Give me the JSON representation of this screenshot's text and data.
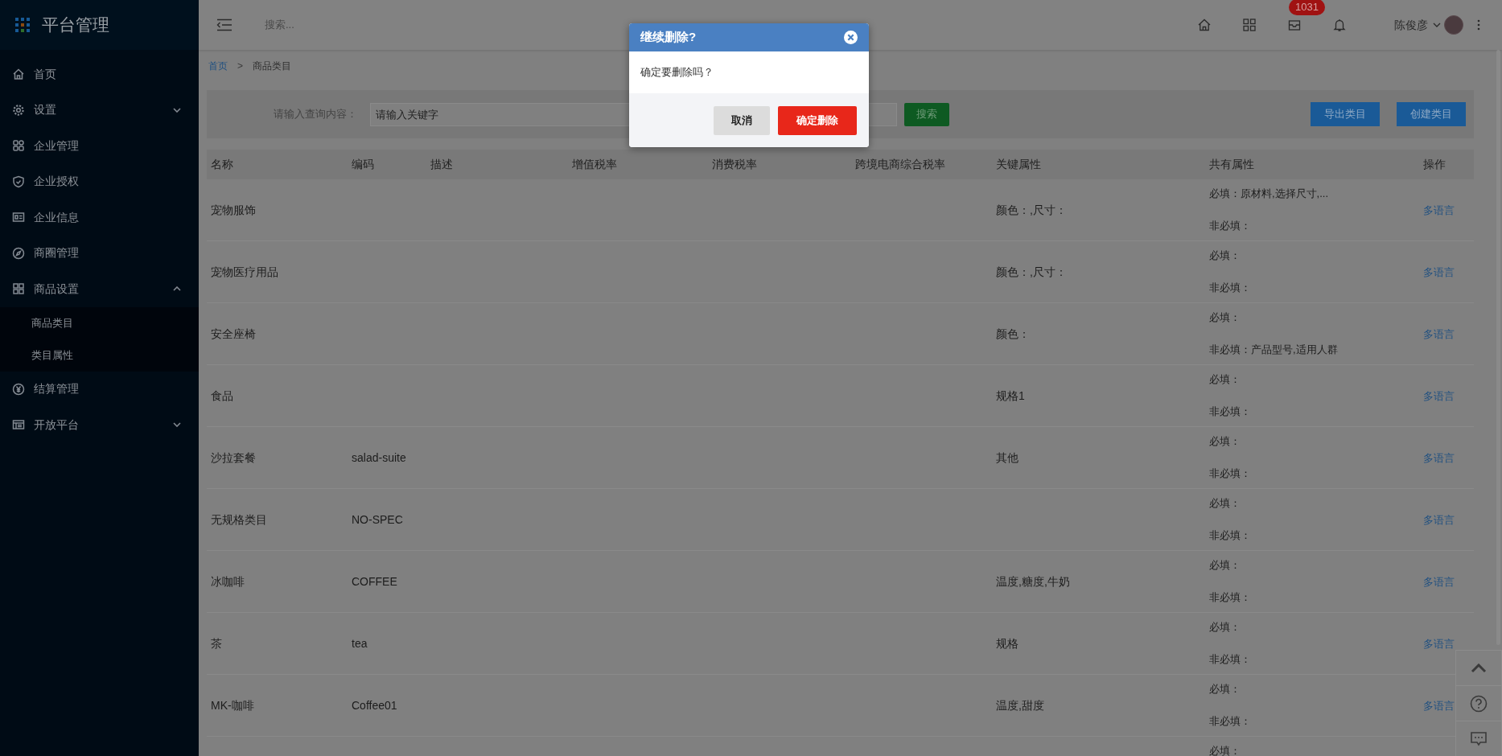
{
  "sidebar": {
    "title": "平台管理",
    "items": [
      {
        "label": "首页",
        "kind": "link"
      },
      {
        "label": "设置",
        "kind": "group",
        "expanded": false
      },
      {
        "label": "企业管理",
        "kind": "link"
      },
      {
        "label": "企业授权",
        "kind": "link"
      },
      {
        "label": "企业信息",
        "kind": "link"
      },
      {
        "label": "商圈管理",
        "kind": "link"
      },
      {
        "label": "商品设置",
        "kind": "group",
        "expanded": true,
        "children": [
          {
            "label": "商品类目"
          },
          {
            "label": "类目属性"
          }
        ]
      },
      {
        "label": "结算管理",
        "kind": "link"
      },
      {
        "label": "开放平台",
        "kind": "group",
        "expanded": false
      }
    ]
  },
  "header": {
    "search_placeholder": "搜索...",
    "badge": "1031",
    "user": "陈俊彦"
  },
  "breadcrumb": [
    {
      "label": "首页",
      "kind": "link"
    },
    {
      "label": ">",
      "kind": "separator"
    },
    {
      "label": "商品类目",
      "kind": "current"
    }
  ],
  "filter": {
    "label": "请输入查询内容：",
    "placeholder": "请输入关键字",
    "search_button": "搜索",
    "buttons": [
      "导出类目",
      "创建类目"
    ]
  },
  "table": {
    "columns": [
      "名称",
      "编码",
      "描述",
      "增值税率",
      "消费税率",
      "跨境电商综合税率",
      "关键属性",
      "共有属性",
      "操作"
    ],
    "rows": [
      {
        "name": "宠物服饰",
        "key_attributes": "颜色：,尺寸：",
        "required": "必填：原材料,选择尺寸,...",
        "optional": "非必填：",
        "action": "多语言"
      },
      {
        "name": "宠物医疗用品",
        "key_attributes": "颜色：,尺寸：",
        "required": "必填：",
        "optional": "非必填：",
        "action": "多语言"
      },
      {
        "name": "安全座椅",
        "key_attributes": "颜色：",
        "required": "必填：",
        "optional": "非必填：产品型号,适用人群",
        "action": "多语言"
      },
      {
        "name": "食品",
        "key_attributes": "规格1",
        "required": "必填：",
        "optional": "非必填：",
        "action": "多语言"
      },
      {
        "name": "沙拉套餐",
        "code": "salad-suite",
        "key_attributes": "其他",
        "required": "必填：",
        "optional": "非必填：",
        "action": "多语言"
      },
      {
        "name": "无规格类目",
        "code": "NO-SPEC",
        "required": "必填：",
        "optional": "非必填：",
        "action": "多语言"
      },
      {
        "name": "冰咖啡",
        "code": "COFFEE",
        "key_attributes": "温度,糖度,牛奶",
        "required": "必填：",
        "optional": "非必填：",
        "action": "多语言"
      },
      {
        "name": "茶",
        "code": "tea",
        "key_attributes": "规格",
        "required": "必填：",
        "optional": "非必填：",
        "action": "多语言"
      },
      {
        "name": "MK-咖啡",
        "code": "Coffee01",
        "key_attributes": "温度,甜度",
        "required": "必填：",
        "optional": "非必填：",
        "action": "多语言"
      },
      {
        "required": "必填："
      }
    ]
  },
  "dialog": {
    "title": "继续删除?",
    "message": "确定要删除吗？",
    "buttons": [
      {
        "label": "取消",
        "kind": "secondary"
      },
      {
        "label": "确定删除",
        "kind": "danger"
      }
    ]
  }
}
